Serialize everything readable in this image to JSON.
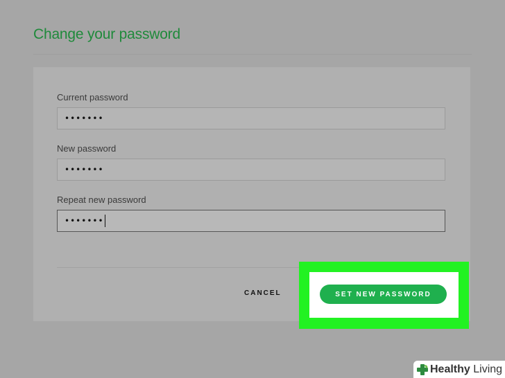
{
  "page": {
    "title": "Change your password"
  },
  "form": {
    "current_password": {
      "label": "Current password",
      "value": "•••••••"
    },
    "new_password": {
      "label": "New password",
      "value": "•••••••"
    },
    "repeat_password": {
      "label": "Repeat new password",
      "value": "•••••••"
    }
  },
  "actions": {
    "cancel_label": "CANCEL",
    "submit_label": "SET NEW PASSWORD"
  },
  "colors": {
    "accent_green": "#1fb04e",
    "title_green": "#1f8a3b",
    "highlight_green": "#22f222"
  },
  "watermark": {
    "brand_part1": "Healthy",
    "brand_part2": " Living",
    "icon": "plus-leaf-icon"
  }
}
